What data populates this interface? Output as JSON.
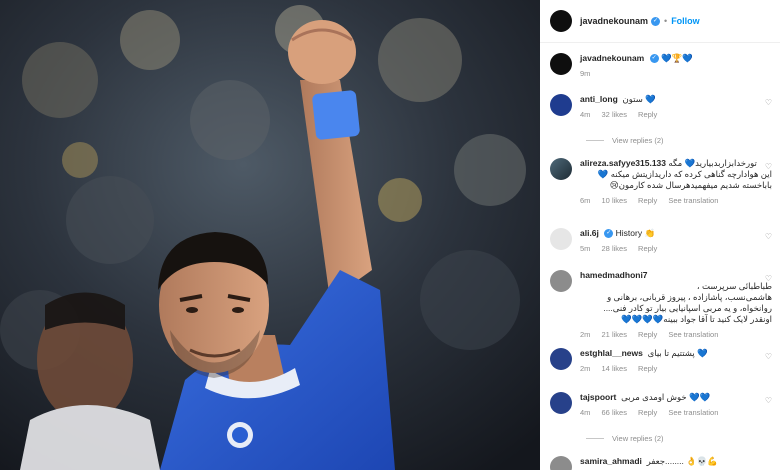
{
  "post": {
    "username": "javadnekounam",
    "follow_label": "Follow",
    "caption_text": "💙🏆💙",
    "caption_time": "9m"
  },
  "comments": [
    {
      "username": "anti_long",
      "text": "ستون 💙",
      "time": "4m",
      "likes": "32 likes",
      "reply": "Reply",
      "view_replies": "View replies (2)"
    },
    {
      "username": "alireza.safyye315.133",
      "text_line1": "تورخدابزاربدبیارید💙 مگه",
      "text_line2": "این هوادارچه گناهی کرده که داریدازیتش میکنه 💙",
      "text_line3": "باباخسته شدیم میفهمیدهرسال شده کارمون😢",
      "time": "6m",
      "likes": "10 likes",
      "reply": "Reply",
      "see_translation": "See translation"
    },
    {
      "username": "ali.6j",
      "text": "History 👏",
      "time": "5m",
      "likes": "28 likes",
      "reply": "Reply"
    },
    {
      "username": "hamedmadhoni7",
      "text_line1": "طباطبائی سرپرست ،",
      "text_line2": "هاشمی‌نسب، پاشازاده ، پیروز قربانی، برهانی و",
      "text_line3": "روانخواه، و یه مربی اسپانیایی بیار تو کادر فنی....",
      "text_line4": "اونقدر لایک کنید تا آقا جواد ببینه💙💙💙💙",
      "time": "2m",
      "likes": "21 likes",
      "reply": "Reply",
      "see_translation": "See translation"
    },
    {
      "username": "estghlal__news",
      "text": "پشتتیم تا بیای 💙",
      "time": "2m",
      "likes": "14 likes",
      "reply": "Reply"
    },
    {
      "username": "tajspoort",
      "text": "خوش اومدی مربی 💙💙",
      "time": "4m",
      "likes": "66 likes",
      "reply": "Reply",
      "see_translation": "See translation",
      "view_replies": "View replies (2)"
    },
    {
      "username": "samira_ahmadi",
      "text": "جعفر........ 👌💀💪"
    }
  ],
  "colors": {
    "accent": "#0095f6",
    "verified": "#3897f0",
    "muted": "#8e8e8e",
    "jersey": "#2a5fd1"
  }
}
